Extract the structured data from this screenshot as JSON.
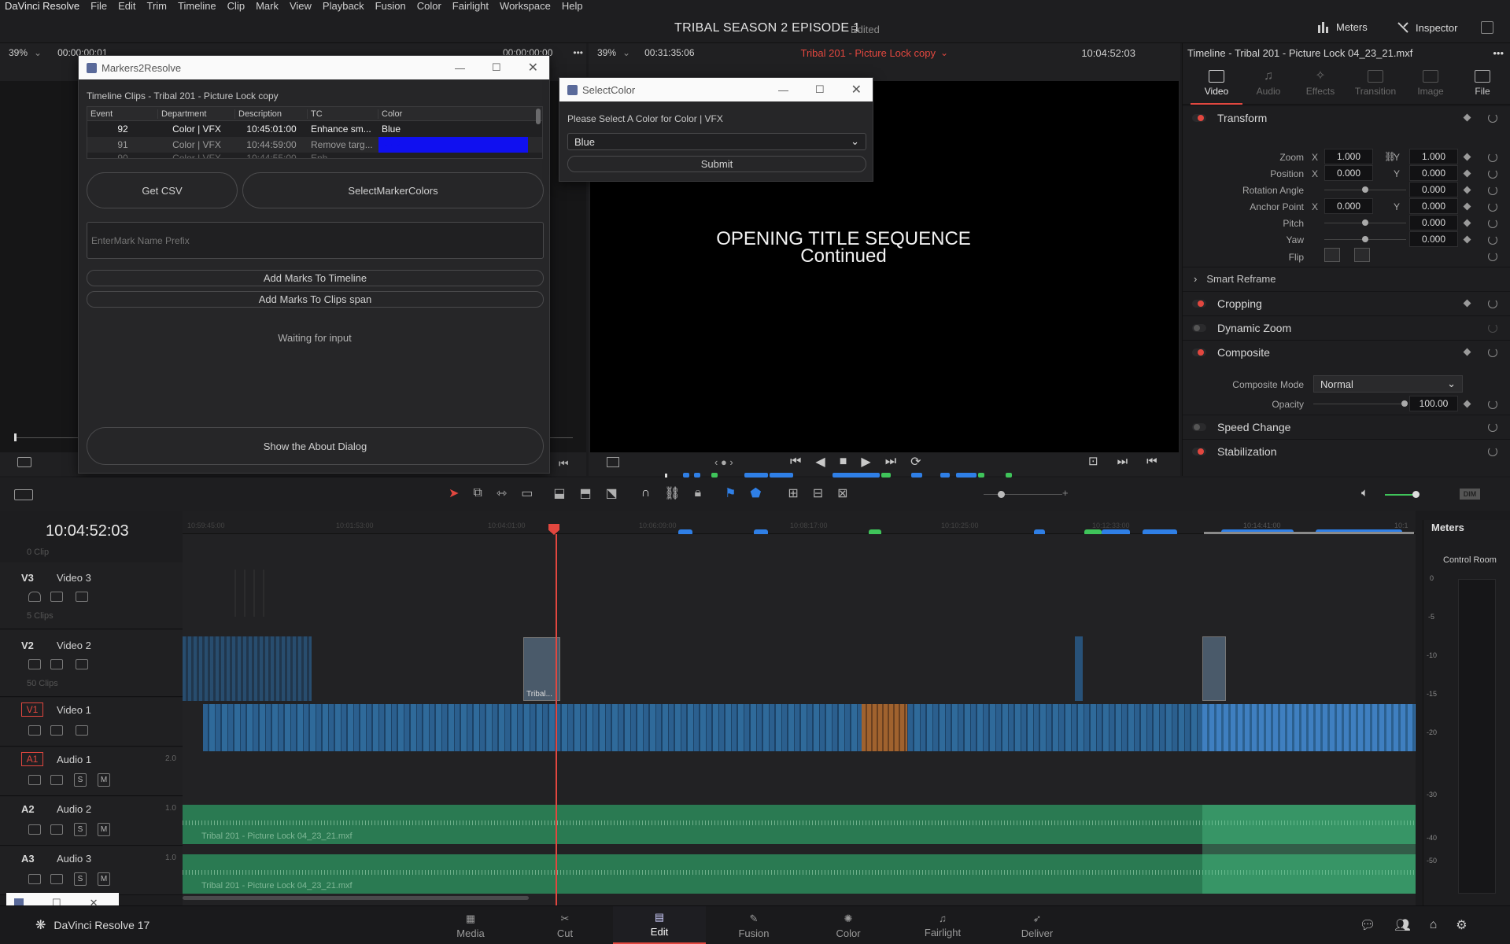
{
  "menubar": {
    "app": "DaVinci Resolve",
    "items": [
      "File",
      "Edit",
      "Trim",
      "Timeline",
      "Clip",
      "Mark",
      "View",
      "Playback",
      "Fusion",
      "Color",
      "Fairlight",
      "Workspace",
      "Help"
    ],
    "project_title": "TRIBAL SEASON 2 EPISODE 1",
    "status": "Edited",
    "meters_label": "Meters",
    "inspector_label": "Inspector"
  },
  "source_viewer": {
    "zoom": "39%",
    "timecode": "00:00:00:01",
    "end_timecode": "00:00:00:00"
  },
  "timeline_viewer": {
    "zoom": "39%",
    "duration": "00:31:35:06",
    "timeline_name": "Tribal 201 - Picture Lock copy",
    "timecode": "10:04:52:03",
    "overlay_line1": "OPENING TITLE SEQUENCE",
    "overlay_line2": "Continued"
  },
  "markers2resolve": {
    "title": "Markers2Resolve",
    "table_title": "Timeline Clips - Tribal 201 - Picture Lock copy",
    "columns": [
      "Event",
      "Department",
      "Description",
      "TC",
      "Color"
    ],
    "rows": [
      {
        "event": "92",
        "department": "Color | VFX",
        "tc": "10:45:01:00",
        "description": "Enhance sm...",
        "color": "Blue"
      },
      {
        "event": "91",
        "department": "Color | VFX",
        "tc": "10:44:59:00",
        "description": "Remove targ...",
        "color": "Blue"
      },
      {
        "event": "90",
        "department": "Color | VFX",
        "tc": "10:44:55:00",
        "description": "Enh...",
        "color": ""
      }
    ],
    "get_csv": "Get CSV",
    "select_colors": "SelectMarkerColors",
    "prefix_placeholder": "EnterMark Name Prefix",
    "add_timeline": "Add Marks To Timeline",
    "add_clips": "Add Marks To Clips span",
    "status": "Waiting for input",
    "about": "Show the About Dialog"
  },
  "selectcolor": {
    "title": "SelectColor",
    "prompt": "Please Select A Color for Color | VFX",
    "selected": "Blue",
    "submit": "Submit"
  },
  "inspector": {
    "header": "Timeline - Tribal 201 - Picture Lock 04_23_21.mxf",
    "tabs": [
      "Video",
      "Audio",
      "Effects",
      "Transition",
      "Image",
      "File"
    ],
    "transform": "Transform",
    "zoom_label": "Zoom",
    "zoom_x": "1.000",
    "zoom_y": "1.000",
    "position_label": "Position",
    "pos_x": "0.000",
    "pos_y": "0.000",
    "rotation_label": "Rotation Angle",
    "rotation": "0.000",
    "anchor_label": "Anchor Point",
    "anchor_x": "0.000",
    "anchor_y": "0.000",
    "pitch_label": "Pitch",
    "pitch": "0.000",
    "yaw_label": "Yaw",
    "yaw": "0.000",
    "flip_label": "Flip",
    "x": "X",
    "y": "Y",
    "smart_reframe": "Smart Reframe",
    "cropping": "Cropping",
    "dynamic_zoom": "Dynamic Zoom",
    "composite": "Composite",
    "composite_mode_label": "Composite Mode",
    "composite_mode": "Normal",
    "opacity_label": "Opacity",
    "opacity": "100.00",
    "speed_change": "Speed Change",
    "stabilization": "Stabilization"
  },
  "timeline": {
    "timecode": "10:04:52:03",
    "ruler": [
      "10:59:45:00",
      "10:01:53:00",
      "10:04:01:00",
      "10:06:09:00",
      "10:08:17:00",
      "10:10:25:00",
      "10:12:33:00",
      "10:14:41:00",
      "10:1"
    ],
    "tracks": {
      "clip0": "0 Clip",
      "v3_id": "V3",
      "v3_name": "Video 3",
      "v3_count": "5 Clips",
      "v2_id": "V2",
      "v2_name": "Video 2",
      "v2_count": "50 Clips",
      "v1_id": "V1",
      "v1_name": "Video 1",
      "a1_id": "A1",
      "a1_name": "Audio 1",
      "a1_ch": "2.0",
      "a2_id": "A2",
      "a2_name": "Audio 2",
      "a2_ch": "1.0",
      "a3_id": "A3",
      "a3_name": "Audio 3",
      "a3_ch": "1.0"
    },
    "audio_clip": "Tribal 201 - Picture Lock 04_23_21.mxf",
    "v2_clip": "Tribal...",
    "solo": "S",
    "mute": "M",
    "dim": "DIM"
  },
  "meters_panel": {
    "title": "Meters",
    "subtitle": "Control Room",
    "scale": [
      "0",
      "-5",
      "-10",
      "-15",
      "-20",
      "-30",
      "-40",
      "-50"
    ]
  },
  "footer": {
    "app_version": "DaVinci Resolve 17"
  },
  "pages": [
    "Media",
    "Cut",
    "Edit",
    "Fusion",
    "Color",
    "Fairlight",
    "Deliver"
  ],
  "colors": {
    "accent": "#e2473f",
    "marker_blue": "#2f7fe6",
    "marker_green": "#3fc45a",
    "audio_green": "#2a8a58",
    "video_blue": "#2b5f8e"
  }
}
